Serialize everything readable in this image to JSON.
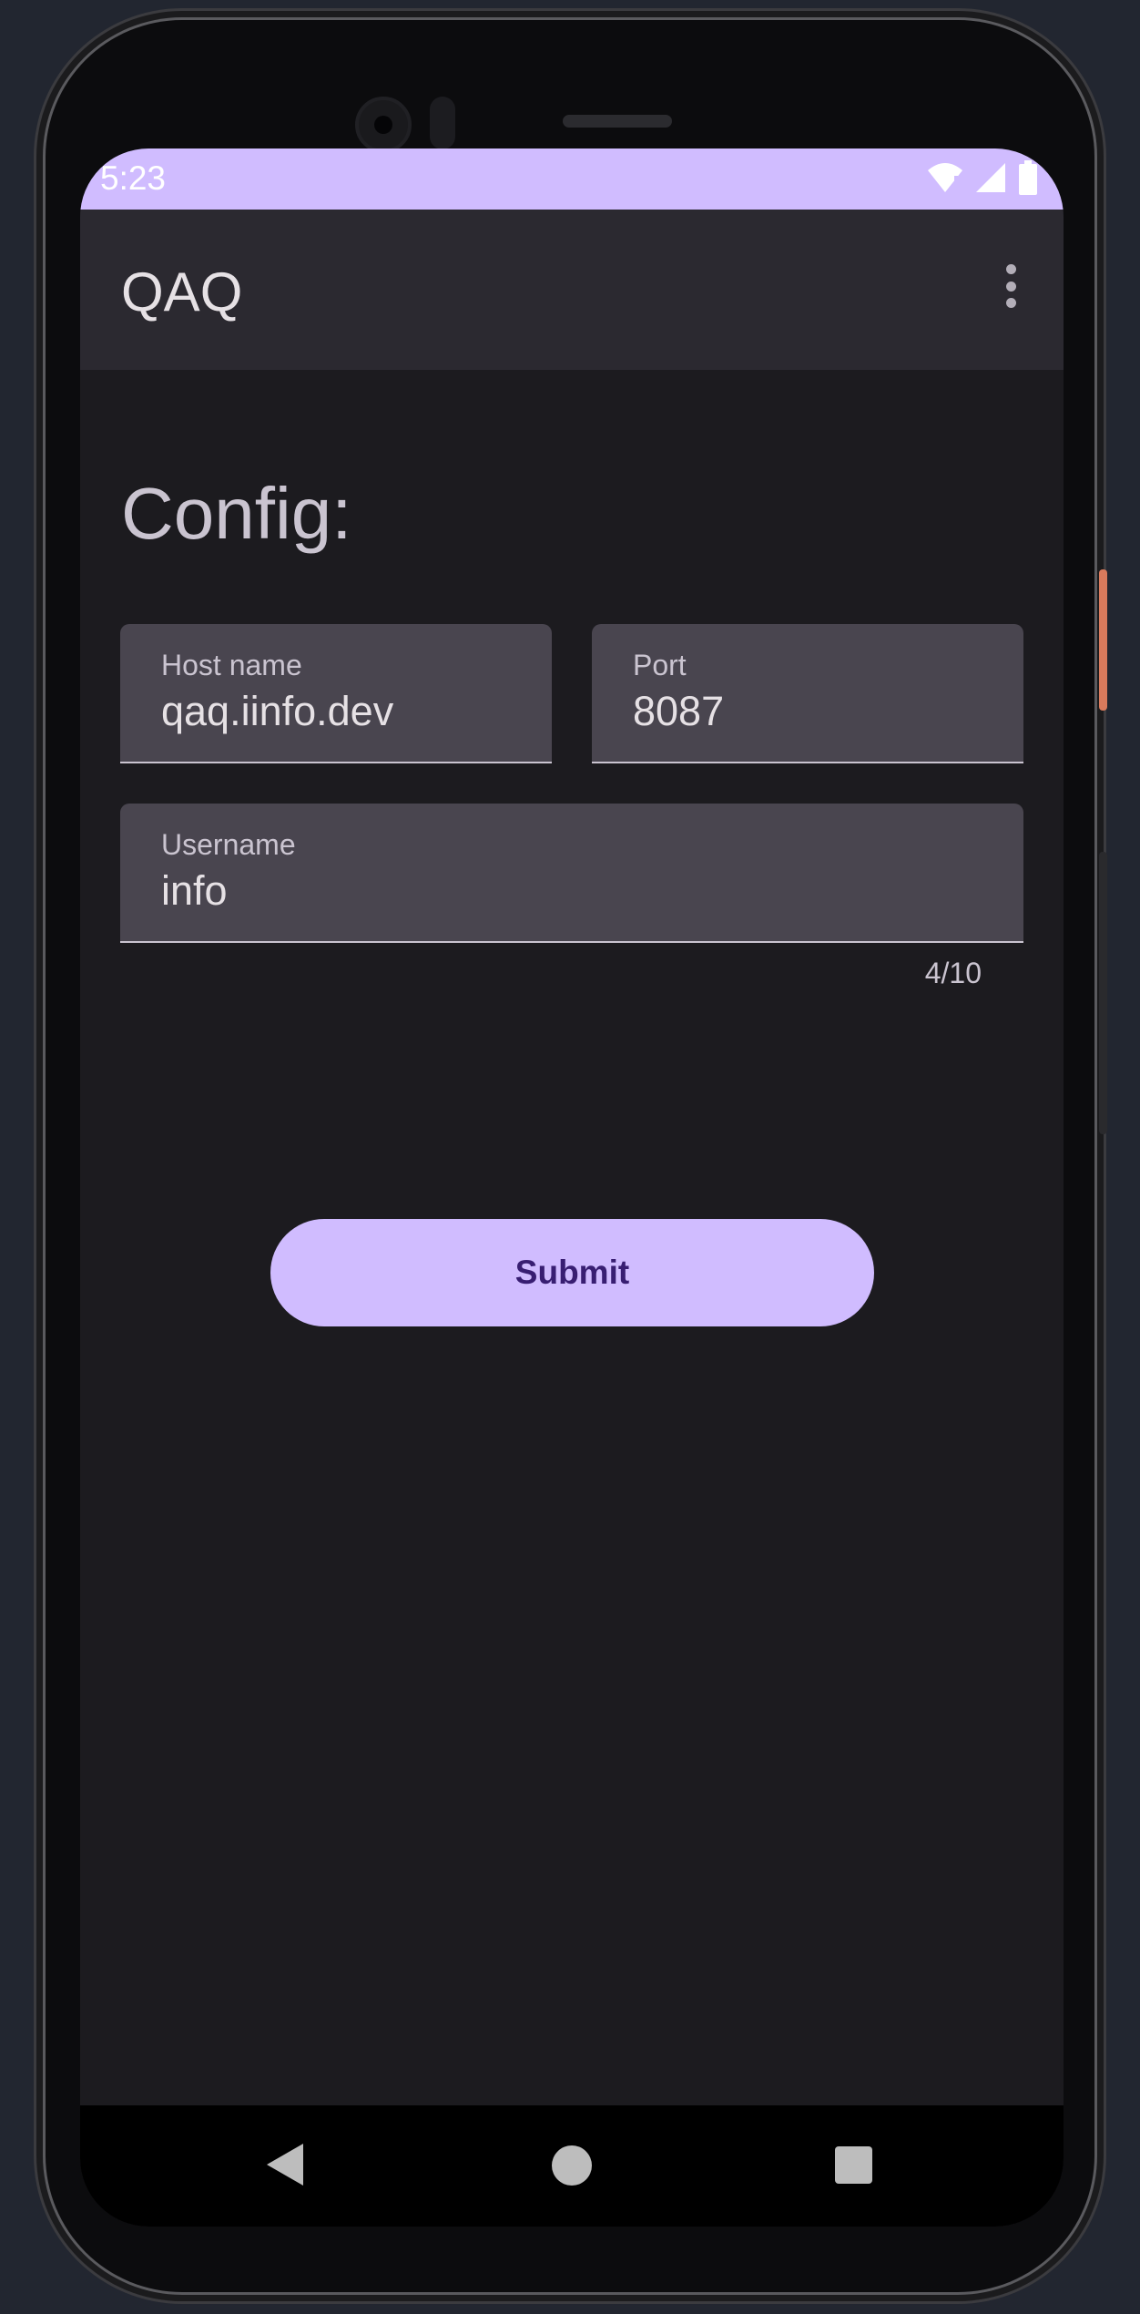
{
  "status_bar": {
    "time": "5:23",
    "icons": [
      "wifi-icon",
      "signal-icon",
      "battery-icon"
    ]
  },
  "app_bar": {
    "title": "QAQ",
    "menu_icon": "more-vert-icon"
  },
  "form": {
    "section_title": "Config:",
    "host": {
      "label": "Host name",
      "value": "qaq.iinfo.dev"
    },
    "port": {
      "label": "Port",
      "value": "8087"
    },
    "username": {
      "label": "Username",
      "value": "info",
      "counter": "4/10"
    },
    "submit_label": "Submit"
  },
  "nav_bar": {
    "icons": [
      "back-icon",
      "home-icon",
      "recents-icon"
    ]
  },
  "colors": {
    "primary": "#d0bcff",
    "on_primary": "#381e72",
    "surface": "#1c1b1f",
    "app_bar": "#2b2930",
    "field": "#49454f",
    "text": "#e6e1e5",
    "text_muted": "#cac4d0"
  }
}
